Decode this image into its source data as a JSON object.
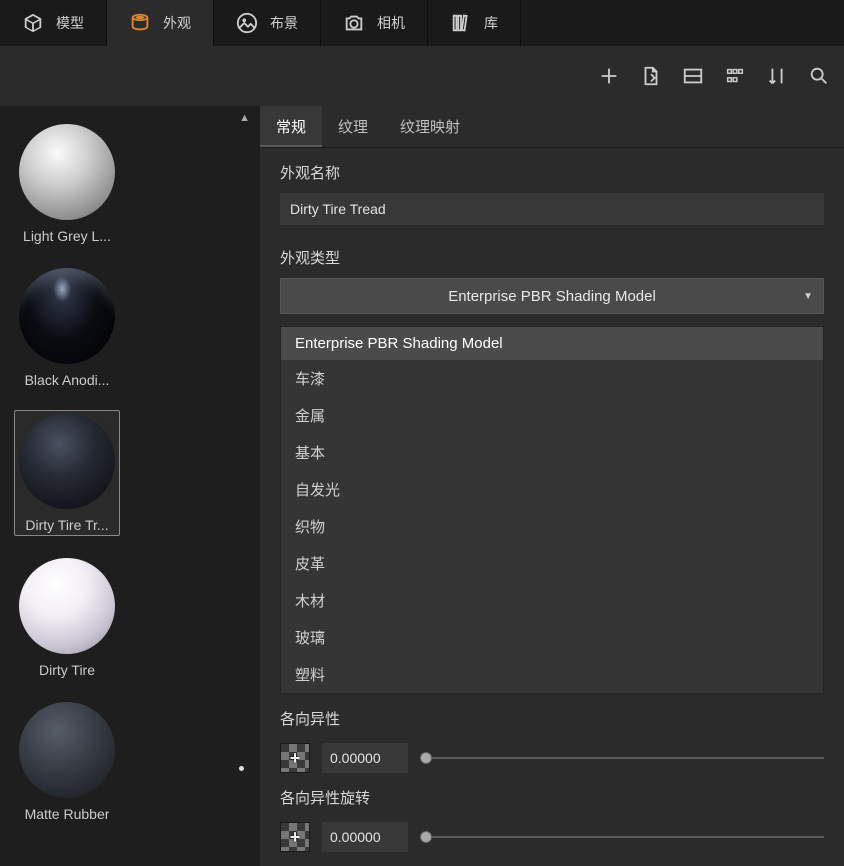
{
  "top_tabs": {
    "model": "模型",
    "appearance": "外观",
    "scene": "布景",
    "camera": "相机",
    "library": "库"
  },
  "materials": [
    {
      "id": "light-grey",
      "label": "Light Grey L..."
    },
    {
      "id": "black-anodized",
      "label": "Black Anodi..."
    },
    {
      "id": "dirty-tire-tread",
      "label": "Dirty Tire Tr..."
    },
    {
      "id": "dirty-tire",
      "label": "Dirty Tire"
    },
    {
      "id": "matte-rubber",
      "label": "Matte Rubber"
    }
  ],
  "sub_tabs": {
    "general": "常规",
    "texture": "纹理",
    "texture_mapping": "纹理映射"
  },
  "labels": {
    "appearance_name": "外观名称",
    "appearance_type": "外观类型",
    "anisotropy": "各向异性",
    "anisotropy_rotation": "各向异性旋转"
  },
  "fields": {
    "name_value": "Dirty Tire Tread",
    "type_selected": "Enterprise PBR Shading Model",
    "anisotropy_value": "0.00000",
    "anisotropy_rotation_value": "0.00000"
  },
  "type_options": [
    "Enterprise PBR Shading Model",
    "车漆",
    "金属",
    "基本",
    "自发光",
    "织物",
    "皮革",
    "木材",
    "玻璃",
    "塑料"
  ]
}
